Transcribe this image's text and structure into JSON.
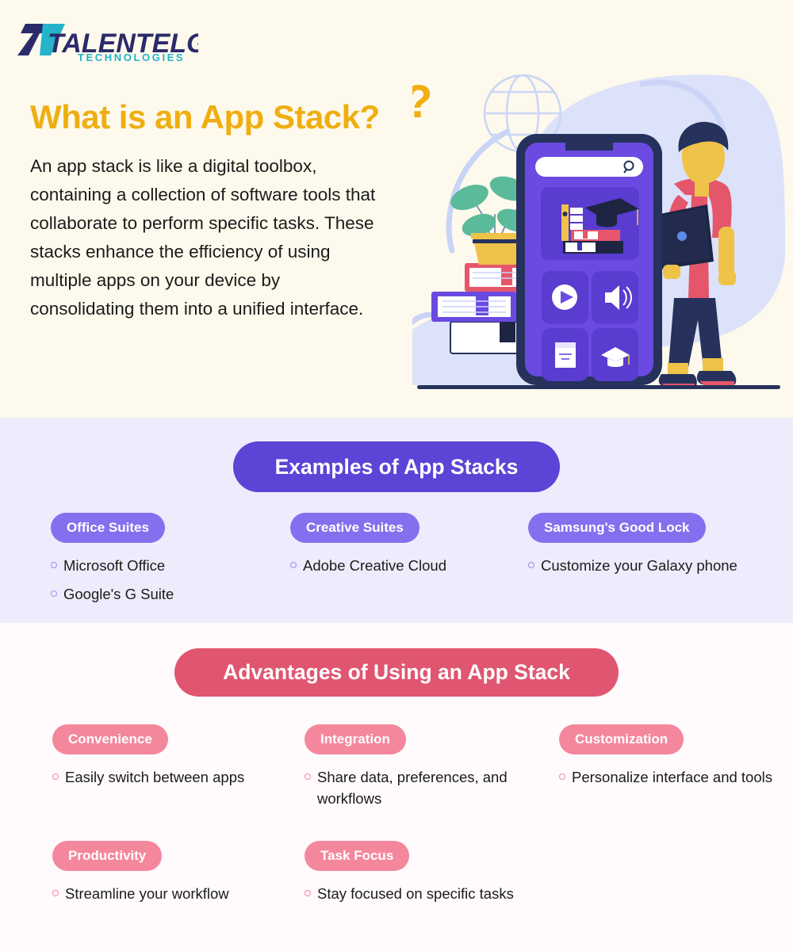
{
  "brand": {
    "name": "TALENTELGIA",
    "tagline": "TECHNOLOGIES",
    "monogram": "7T",
    "color_dark": "#2B2A6B",
    "color_teal": "#24B3C9"
  },
  "hero": {
    "title": "What is an App Stack?",
    "title_color": "#EFAE11",
    "body": "An app stack is like a digital toolbox, containing a collection of software tools that collaborate to perform specific tasks. These stacks enhance the efficiency of using multiple apps on your device by consolidating them into a unified interface.",
    "background": "#FDF9EC",
    "illustration": {
      "name": "person-with-tablet-and-giant-smartphone",
      "question_mark": "?",
      "phone": {
        "frame_color": "#26325B",
        "screen_color": "#6A4AE0",
        "search_placeholder": "",
        "search_icon": "search-icon",
        "featured_card": "books-and-graduation-cap",
        "app_tiles": [
          "play-icon",
          "speaker-icon",
          "document-icon",
          "graduation-cap-icon"
        ]
      },
      "props": [
        "globe-outline",
        "potted-plant",
        "book-stack",
        "blue-blob"
      ]
    }
  },
  "examples": {
    "background": "#EEECFC",
    "heading": "Examples of App Stacks",
    "heading_color": "#5B44D6",
    "pill_color": "#8470EE",
    "bullet_color": "#9C8DF0",
    "columns": [
      {
        "label": "Office Suites",
        "items": [
          "Microsoft Office",
          "Google's G Suite"
        ]
      },
      {
        "label": "Creative Suites",
        "items": [
          "Adobe Creative Cloud"
        ]
      },
      {
        "label": "Samsung's Good Lock",
        "items": [
          "Customize your Galaxy phone"
        ]
      }
    ]
  },
  "advantages": {
    "background": "#FFFAFB",
    "heading": "Advantages of Using an App Stack",
    "heading_color": "#E05670",
    "pill_color": "#F4879C",
    "bullet_color": "#F4879C",
    "columns": [
      {
        "label": "Convenience",
        "items": [
          "Easily switch between apps"
        ]
      },
      {
        "label": "Integration",
        "items": [
          "Share data, preferences, and workflows"
        ]
      },
      {
        "label": "Customization",
        "items": [
          "Personalize interface and tools"
        ]
      },
      {
        "label": "Productivity",
        "items": [
          "Streamline your workflow"
        ]
      },
      {
        "label": "Task Focus",
        "items": [
          "Stay focused on specific tasks"
        ]
      }
    ]
  }
}
